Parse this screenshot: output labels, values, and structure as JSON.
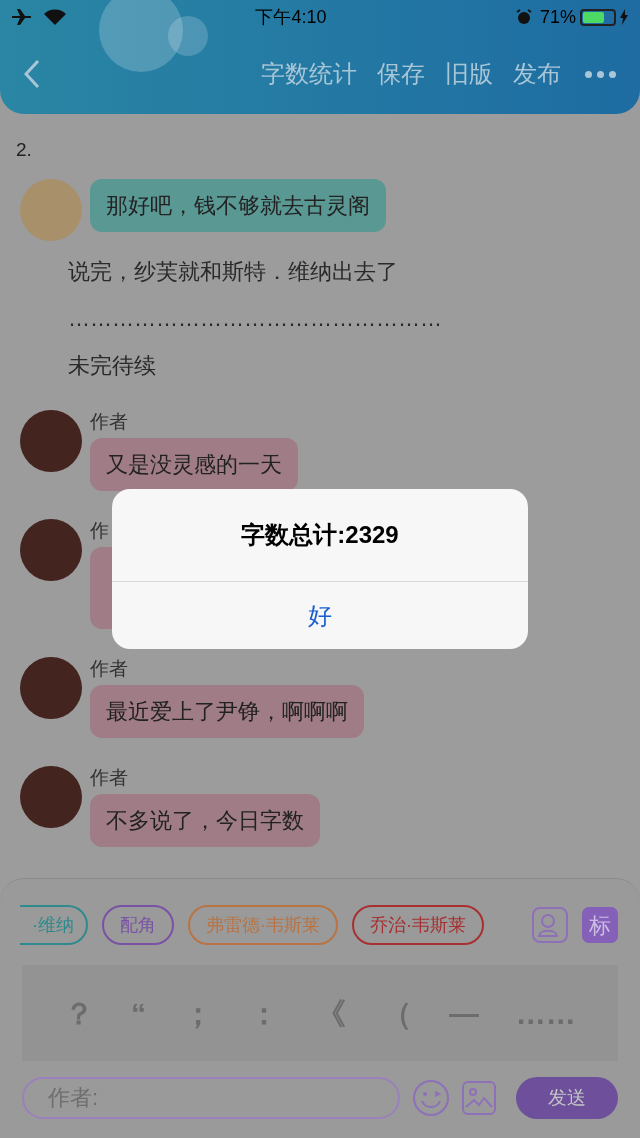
{
  "status_bar": {
    "time": "下午4:10",
    "battery": "71%"
  },
  "nav": {
    "actions": [
      "字数统计",
      "保存",
      "旧版",
      "发布"
    ]
  },
  "content": {
    "section_number": "2.",
    "items": [
      {
        "kind": "message",
        "text": "那好吧，钱不够就去古灵阁",
        "color": "#5a9894"
      },
      {
        "kind": "narration",
        "text": "说完，纱芙就和斯特．维纳出去了"
      },
      {
        "kind": "narration",
        "text": "……………………………………………"
      },
      {
        "kind": "narration",
        "text": "未完待续"
      },
      {
        "kind": "message",
        "name": "作者",
        "text": "又是没灵感的一天",
        "color": "#a07c86"
      },
      {
        "kind": "message",
        "name": "作",
        "color": "#a07c86"
      },
      {
        "kind": "message",
        "name": "作者",
        "text": "最近爱上了尹铮，啊啊啊",
        "color": "#a07c86"
      },
      {
        "kind": "message",
        "name": "作者",
        "text": "不多说了，今日字数",
        "color": "#a07c86"
      }
    ]
  },
  "dialog": {
    "message": "字数总计:2329",
    "button": "好"
  },
  "composer": {
    "role_chips": [
      {
        "label": "·维纳",
        "color": "#2e8a8c"
      },
      {
        "label": "配角",
        "color": "#7a52a4"
      },
      {
        "label": "弗雷德·韦斯莱",
        "color": "#b87444"
      },
      {
        "label": "乔治·韦斯莱",
        "color": "#a83030"
      }
    ],
    "tag_button": "标",
    "punctuation": [
      "？",
      "“",
      "；",
      "：",
      "《",
      "（",
      "—",
      "……"
    ],
    "input": {
      "placeholder": "作者:"
    },
    "send_button": "发送"
  }
}
